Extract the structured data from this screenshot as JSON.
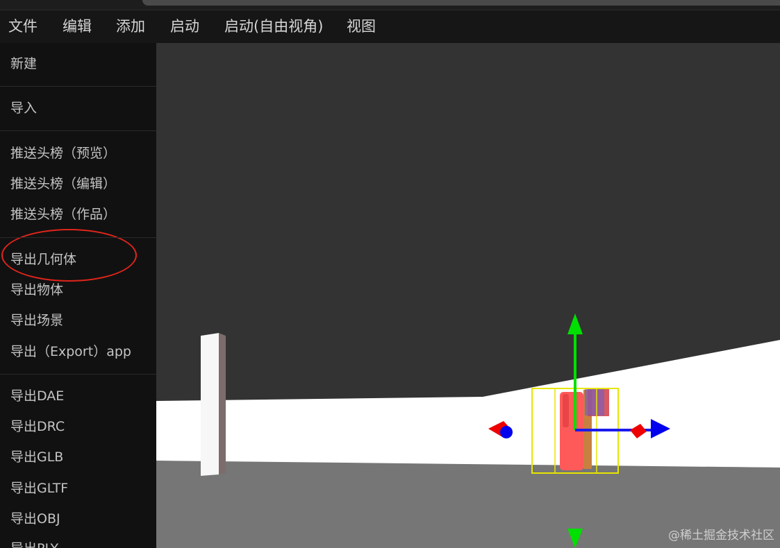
{
  "menubar": {
    "items": [
      "文件",
      "编辑",
      "添加",
      "启动",
      "启动(自由视角)",
      "视图"
    ]
  },
  "sidebar": {
    "items": [
      "新建",
      "导入",
      "推送头榜（预览）",
      "推送头榜（编辑）",
      "推送头榜（作品）",
      "导出几何体",
      "导出物体",
      "导出场景",
      "导出（Export）app",
      "导出DAE",
      "导出DRC",
      "导出GLB",
      "导出GLTF",
      "导出OBJ",
      "导出PLY"
    ]
  },
  "watermark": "@稀土掘金技术社区",
  "colors": {
    "annotation": "#e0251b",
    "gizmo_y": "#00e000",
    "gizmo_z": "#0000ee",
    "gizmo_x": "#e00000",
    "selection_box": "#e6e600",
    "viewport_bg": "#333333"
  },
  "icons": [
    "translate-gizmo",
    "arrow-up-icon",
    "arrow-down-icon",
    "arrow-left-icon",
    "arrow-right-icon"
  ]
}
